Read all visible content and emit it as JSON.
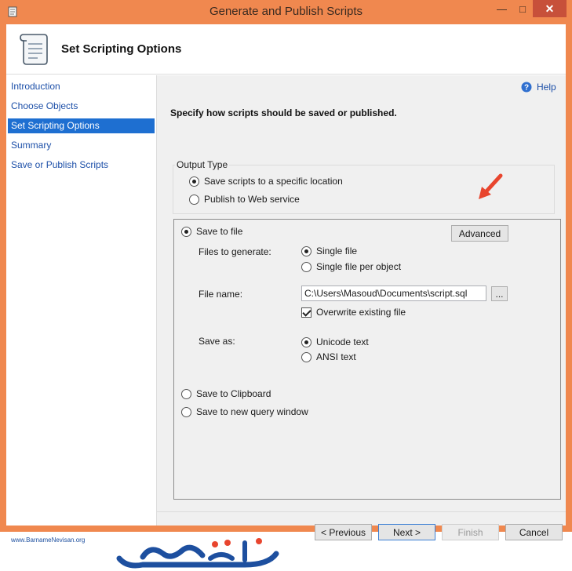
{
  "window": {
    "title": "Generate and Publish Scripts",
    "minimize_glyph": "—",
    "maximize_glyph": "□",
    "close_glyph": "✕"
  },
  "header": {
    "title": "Set Scripting Options"
  },
  "sidebar": {
    "items": [
      {
        "label": "Introduction"
      },
      {
        "label": "Choose Objects"
      },
      {
        "label": "Set Scripting Options"
      },
      {
        "label": "Summary"
      },
      {
        "label": "Save or Publish Scripts"
      }
    ]
  },
  "content": {
    "help_label": "Help",
    "instruction": "Specify how scripts should be saved or published.",
    "output_type": {
      "label": "Output Type",
      "save_specific": "Save scripts to a specific location",
      "publish_web": "Publish to Web service"
    },
    "save_to_file": {
      "label": "Save to file",
      "advanced_label": "Advanced",
      "files_label": "Files to generate:",
      "single_file": "Single file",
      "single_per_object": "Single file per object",
      "file_name_label": "File name:",
      "file_name_value": "C:\\Users\\Masoud\\Documents\\script.sql",
      "browse_label": "...",
      "overwrite_label": "Overwrite existing file",
      "save_as_label": "Save as:",
      "unicode_label": "Unicode text",
      "ansi_label": "ANSI text"
    },
    "clipboard_label": "Save to Clipboard",
    "query_window_label": "Save to new query window"
  },
  "footer": {
    "previous": "< Previous",
    "next": "Next >",
    "finish": "Finish",
    "cancel": "Cancel"
  },
  "watermark": {
    "url": "www.BarnameNevisan.org"
  },
  "colors": {
    "frame": "#f0884f",
    "selection": "#1e6fd1",
    "link": "#1c4fa8",
    "arrow": "#e8452e"
  }
}
